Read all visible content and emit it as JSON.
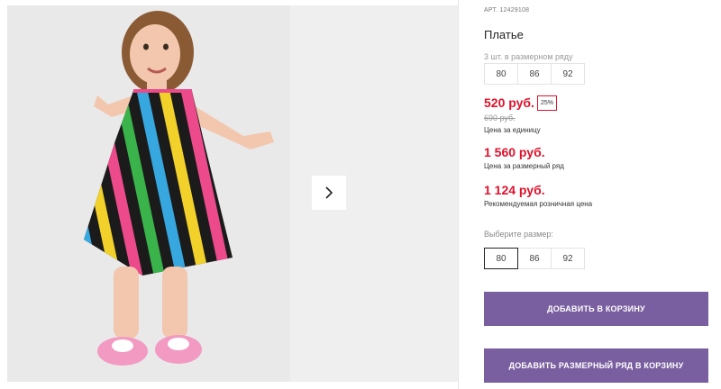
{
  "product": {
    "sku": "АРТ. 12429108",
    "title": "Платье",
    "pack_label": "3 шт. в размерном ряду",
    "pack_sizes": [
      "80",
      "86",
      "92"
    ],
    "price_unit": "520 руб.",
    "discount": "25%",
    "old_price": "690 руб.",
    "price_unit_note": "Цена за единицу",
    "price_pack": "1 560 руб.",
    "price_pack_note": "Цена за размерный ряд",
    "price_retail": "1 124 руб.",
    "price_retail_note": "Рекомендуемая розничная цена",
    "choose_size_label": "Выберите размер:",
    "sizes": [
      "80",
      "86",
      "92"
    ],
    "selected_size": "80"
  },
  "actions": {
    "add_to_cart": "ДОБАВИТЬ В КОРЗИНУ",
    "add_pack_to_cart": "ДОБАВИТЬ РАЗМЕРНЫЙ РЯД В КОРЗИНУ"
  },
  "gallery": {
    "next_icon": "chevron-right-icon"
  },
  "colors": {
    "accent_button": "#7a5fa0",
    "price": "#e0112b"
  }
}
